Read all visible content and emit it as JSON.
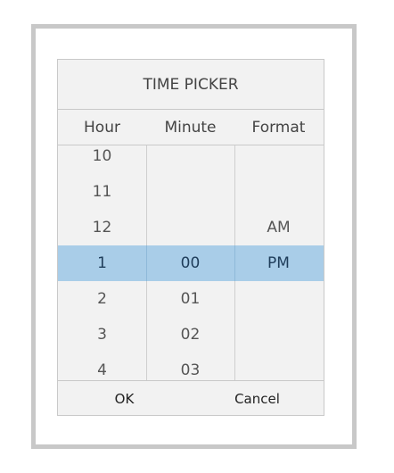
{
  "picker": {
    "title": "TIME PICKER",
    "headers": {
      "hour": "Hour",
      "minute": "Minute",
      "format": "Format"
    },
    "hour": {
      "above": [
        "10",
        "11",
        "12"
      ],
      "selected": "1",
      "below": [
        "2",
        "3",
        "4"
      ]
    },
    "minute": {
      "selected": "00",
      "below": [
        "01",
        "02",
        "03"
      ]
    },
    "format": {
      "above": [
        "AM"
      ],
      "selected": "PM"
    },
    "buttons": {
      "ok": "OK",
      "cancel": "Cancel"
    },
    "colors": {
      "selection": "#a9cde8",
      "panel": "#f2f2f2",
      "frame": "#c8c8c8"
    }
  }
}
